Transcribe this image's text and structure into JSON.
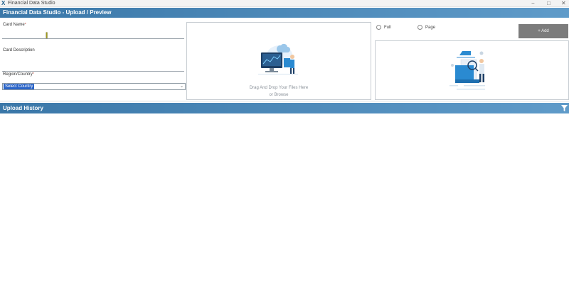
{
  "window": {
    "title": "Financial Data Studio",
    "controls": {
      "minimize": "−",
      "maximize": "□",
      "close": "✕"
    }
  },
  "header": {
    "title": "Financial Data Studio - Upload / Preview"
  },
  "form": {
    "card_name_label": "Card Name",
    "card_name_value": "",
    "card_description_label": "Card Description",
    "card_description_value": "",
    "region_label": "Region/Country",
    "region_selected": "Select Country",
    "required_marker": "*"
  },
  "upload": {
    "drop_text": "Drag And Drop Your Files Here",
    "browse_text": "or Browse"
  },
  "preview": {
    "radio_full": "Full",
    "radio_page": "Page",
    "add_button": "+ Add"
  },
  "history": {
    "title": "Upload History"
  },
  "colors": {
    "banner": "#3a77a8",
    "accent": "#2a8ad1",
    "add_button": "#7c7c7c"
  },
  "icons": {
    "app": "app-x-icon",
    "filter": "filter-icon",
    "select_chevron": "chevron-down-icon"
  }
}
